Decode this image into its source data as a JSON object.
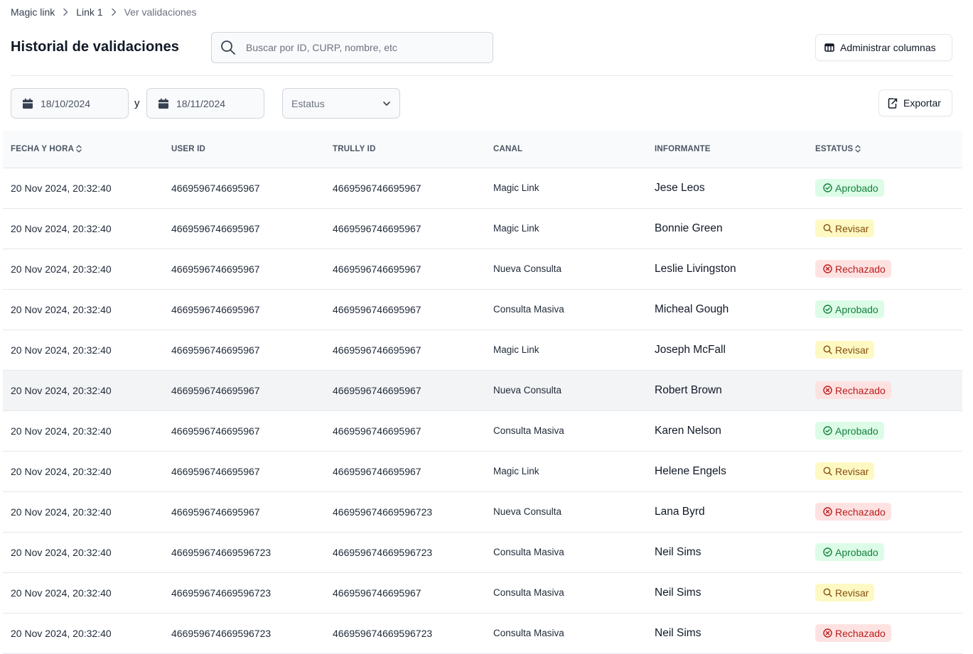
{
  "breadcrumb": {
    "items": [
      "Magic link",
      "Link 1",
      "Ver validaciones"
    ]
  },
  "header": {
    "title": "Historial de validaciones",
    "search_placeholder": "Buscar por ID, CURP, nombre, etc",
    "search_value": "",
    "manage_columns_label": "Administrar columnas"
  },
  "filters": {
    "date_from": "18/10/2024",
    "date_separator": "y",
    "date_to": "18/11/2024",
    "status_label": "Estatus",
    "export_label": "Exportar"
  },
  "icons": {
    "search": "search-icon",
    "columns": "columns-icon",
    "calendar": "calendar-icon",
    "chevron": "chevron-down-icon",
    "export": "export-icon",
    "sort": "sort-icon",
    "approved": "check-circle-icon",
    "review": "magnifier-icon",
    "rejected": "x-circle-icon"
  },
  "colors": {
    "approved_bg": "#dcfce7",
    "approved_text": "#15803d",
    "review_bg": "#fef9c3",
    "review_text": "#854d0e",
    "rejected_bg": "#fee2e2",
    "rejected_text": "#b91c1c"
  },
  "table": {
    "columns": [
      "FECHA Y HORA",
      "USER ID",
      "TRULLY ID",
      "CANAL",
      "INFORMANTE",
      "ESTATUS"
    ],
    "rows": [
      {
        "fecha": "20 Nov 2024, 20:32:40",
        "user_id": "4669596746695967",
        "trully_id": "4669596746695967",
        "canal": "Magic Link",
        "informante": "Jese Leos",
        "estatus": "Aprobado",
        "status_type": "aprobado"
      },
      {
        "fecha": "20 Nov 2024, 20:32:40",
        "user_id": "4669596746695967",
        "trully_id": "4669596746695967",
        "canal": "Magic Link",
        "informante": "Bonnie Green",
        "estatus": "Revisar",
        "status_type": "revisar"
      },
      {
        "fecha": "20 Nov 2024, 20:32:40",
        "user_id": "4669596746695967",
        "trully_id": "4669596746695967",
        "canal": "Nueva Consulta",
        "informante": "Leslie Livingston",
        "estatus": "Rechazado",
        "status_type": "rechazado"
      },
      {
        "fecha": "20 Nov 2024, 20:32:40",
        "user_id": "4669596746695967",
        "trully_id": "4669596746695967",
        "canal": "Consulta Masiva",
        "informante": "Micheal Gough",
        "estatus": "Aprobado",
        "status_type": "aprobado"
      },
      {
        "fecha": "20 Nov 2024, 20:32:40",
        "user_id": "4669596746695967",
        "trully_id": "4669596746695967",
        "canal": "Magic Link",
        "informante": "Joseph McFall",
        "estatus": "Revisar",
        "status_type": "revisar"
      },
      {
        "fecha": "20 Nov 2024, 20:32:40",
        "user_id": "4669596746695967",
        "trully_id": "4669596746695967",
        "canal": "Nueva Consulta",
        "informante": "Robert Brown",
        "estatus": "Rechazado",
        "status_type": "rechazado",
        "highlighted": true
      },
      {
        "fecha": "20 Nov 2024, 20:32:40",
        "user_id": "4669596746695967",
        "trully_id": "4669596746695967",
        "canal": "Consulta Masiva",
        "informante": "Karen Nelson",
        "estatus": "Aprobado",
        "status_type": "aprobado"
      },
      {
        "fecha": "20 Nov 2024, 20:32:40",
        "user_id": "4669596746695967",
        "trully_id": "4669596746695967",
        "canal": "Magic Link",
        "informante": "Helene Engels",
        "estatus": "Revisar",
        "status_type": "revisar"
      },
      {
        "fecha": "20 Nov 2024, 20:32:40",
        "user_id": "4669596746695967",
        "trully_id": "466959674669596723",
        "canal": "Nueva Consulta",
        "informante": "Lana Byrd",
        "estatus": "Rechazado",
        "status_type": "rechazado"
      },
      {
        "fecha": "20 Nov 2024, 20:32:40",
        "user_id": "466959674669596723",
        "trully_id": "466959674669596723",
        "canal": "Consulta Masiva",
        "informante": "Neil Sims",
        "estatus": "Aprobado",
        "status_type": "aprobado"
      },
      {
        "fecha": "20 Nov 2024, 20:32:40",
        "user_id": "466959674669596723",
        "trully_id": "4669596746695967",
        "canal": "Consulta Masiva",
        "informante": "Neil Sims",
        "estatus": "Revisar",
        "status_type": "revisar"
      },
      {
        "fecha": "20 Nov 2024, 20:32:40",
        "user_id": "466959674669596723",
        "trully_id": "466959674669596723",
        "canal": "Consulta Masiva",
        "informante": "Neil Sims",
        "estatus": "Rechazado",
        "status_type": "rechazado"
      }
    ]
  }
}
